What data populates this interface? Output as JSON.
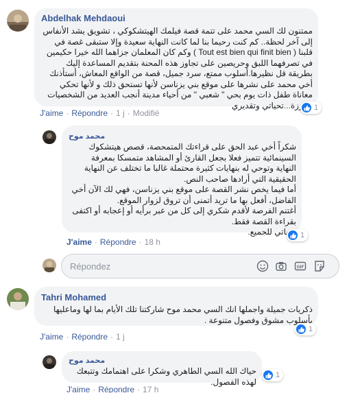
{
  "comments": [
    {
      "author": "Abdelhak Mehdaoui",
      "text": "ممتنون لك السي محمد على تتمة قصة فيلمك الهيتشكوكي ، تشويق يشد الأنفاس إلى آخر لحظة.. كم كنت رحيما بنا لما كانت النهاية سعيدة وإلا ستبقى غصة في قلبنا ( Tout est bien qui finit bien ) وكم كان المعلمان جزاهما الله خيرا حكيمين في تصرفهما اللبق وحريصين على تجاوز هذه المحنة بتقديم المساعدة إليك بطريقة قل نظيرها.أسلوب ممتع، سرد جميل، قصة من الواقع المعاش، أستأذنك أخي محمد على نشرها على موقع بني يزناسن لأنها تستحق ذلك و لأنها تحكي معاناة طفل ذات يوم بحي \" شعبي \" من أحياء مدينة أنجب العديد من الشخصيات البارزة...تحياتي وتقديري",
      "like": "J'aime",
      "reply": "Répondre",
      "time": "1 j",
      "edited": "Modifié",
      "reaction_count": "1"
    },
    {
      "author": "محمد موح",
      "text": "شكراً أخي عبد الحق على قراءتك المتمحصة، قصص هيتشكوك السينمائية تتميز فعلا بجعل القارئ أو المشاهد متمسكا بمعرفة النهاية وتوحي له بنهايات كثيرة محتملة غالبا ما تختلف عن النهاية الحقيقية التي أرادها صاحب النص.\nأما فيما يخص نشر القصة على موقع بني يزناسن، فهي لك الآن أخي الفاضل، أفعل بها ما تريد أتمنى أن تروق لزوار الموقع.\nأغتنم الفرصة لأقدم شكري إلى كل من عبر برأيه أو إعجابه أو اكتفى بقراءة القصة فقط.\nتحياتي للجميع.",
      "like": "J'aime",
      "reply": "Répondre",
      "time": "18 h",
      "reaction_count": "1"
    },
    {
      "author": "Tahri Mohamed",
      "text": "ذكريات جميلة واجملها انك السي محمد موح شاركتنا تلك الأيام بما لها وماعليها بأسلوب مشوق وفصول متنوعة .",
      "like": "J'aime",
      "reply": "Répondre",
      "time": "1 j",
      "reaction_count": "1"
    },
    {
      "author": "محمد موح",
      "text": "حياك الله السي الطاهري وشكرا على اهتمامك وتتبعك لهذه الفصول.",
      "like": "J'aime",
      "reply": "Répondre",
      "time": "17 h",
      "reaction_count": "1"
    }
  ],
  "reply_box": {
    "placeholder": "Répondez"
  },
  "icons": [
    "avatar",
    "emoji-icon",
    "camera-icon",
    "gif-icon",
    "sticker-icon",
    "like-icon"
  ],
  "colors": {
    "link": "#385898",
    "bubble": "#f2f3f5",
    "like_blue": "#1877f2",
    "muted": "#90949c"
  }
}
